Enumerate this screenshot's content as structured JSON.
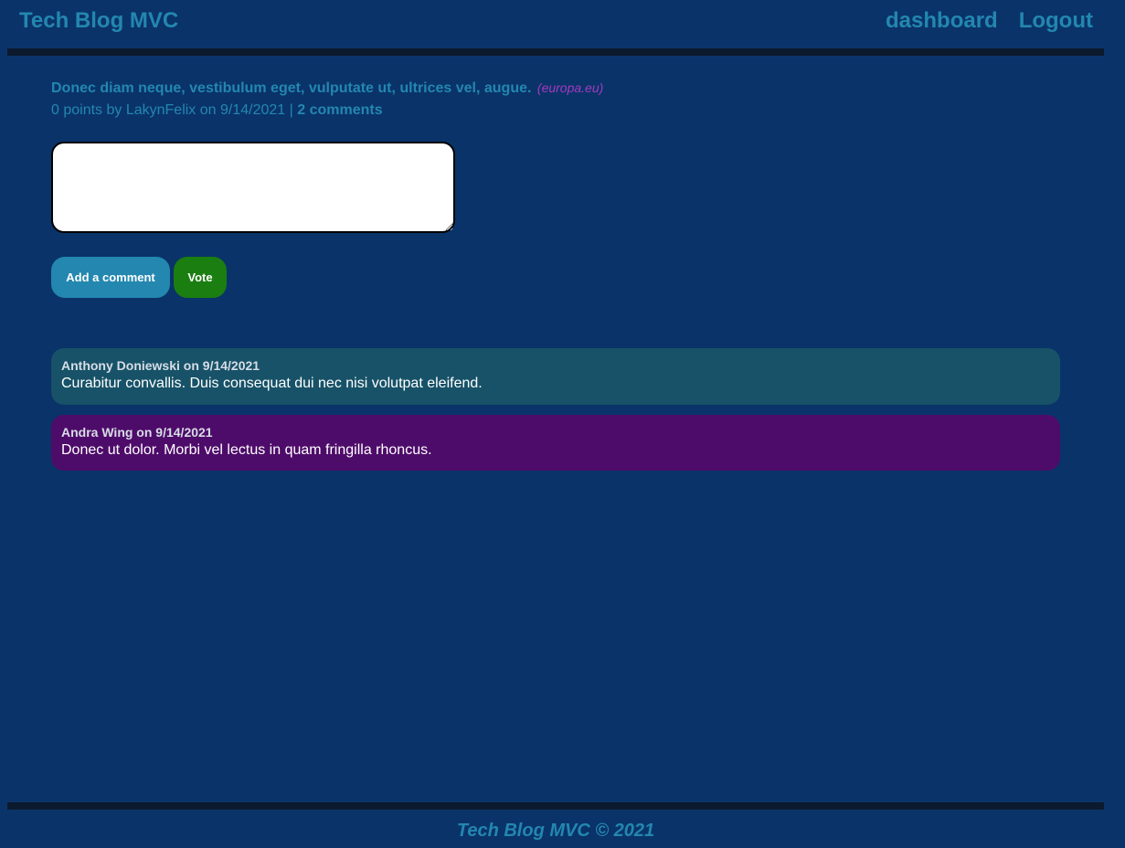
{
  "header": {
    "title": "Tech Blog MVC",
    "nav": {
      "dashboard": "dashboard",
      "logout": "Logout"
    }
  },
  "post": {
    "title": "Donec diam neque, vestibulum eget, vulputate ut, ultrices vel, augue.",
    "source": "(europa.eu)",
    "meta_prefix": "0 points by LakynFelix on 9/14/2021 | ",
    "comments_link": "2 comments"
  },
  "comment_form": {
    "value": "",
    "add_comment_label": "Add a comment",
    "vote_label": "Vote"
  },
  "comments": [
    {
      "author_line": "Anthony Doniewski on 9/14/2021",
      "text": "Curabitur convallis. Duis consequat dui nec nisi volutpat eleifend."
    },
    {
      "author_line": "Andra Wing on 9/14/2021",
      "text": "Donec ut dolor. Morbi vel lectus in quam fringilla rhoncus."
    }
  ],
  "footer": {
    "text": "Tech Blog MVC © 2021"
  },
  "colors": {
    "background": "#0a3369",
    "accent": "#2387b0",
    "vote_button": "#1b7e10",
    "comment_1_bg": "#175268",
    "comment_2_bg": "#4e0c6a",
    "source_text": "#a33bbd"
  }
}
